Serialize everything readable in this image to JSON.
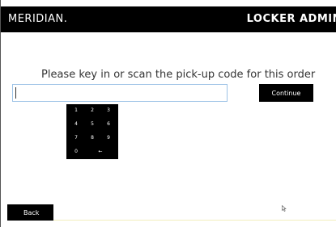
{
  "header": {
    "brand": "MERIDIAN.",
    "title": "LOCKER ADMIN"
  },
  "main": {
    "prompt": "Please key in or scan the pick-up code for this order",
    "code_input": {
      "value": "",
      "placeholder": ""
    },
    "continue_label": "Continue"
  },
  "keypad": {
    "keys": [
      "1",
      "2",
      "3",
      "4",
      "5",
      "6",
      "7",
      "8",
      "9",
      "0",
      "←"
    ]
  },
  "footer": {
    "back_label": "Back"
  },
  "icons": {
    "cursor": "mouse-pointer-icon"
  },
  "colors": {
    "header_bg": "#000000",
    "input_border": "#9ec3e6",
    "button_bg": "#000000"
  }
}
